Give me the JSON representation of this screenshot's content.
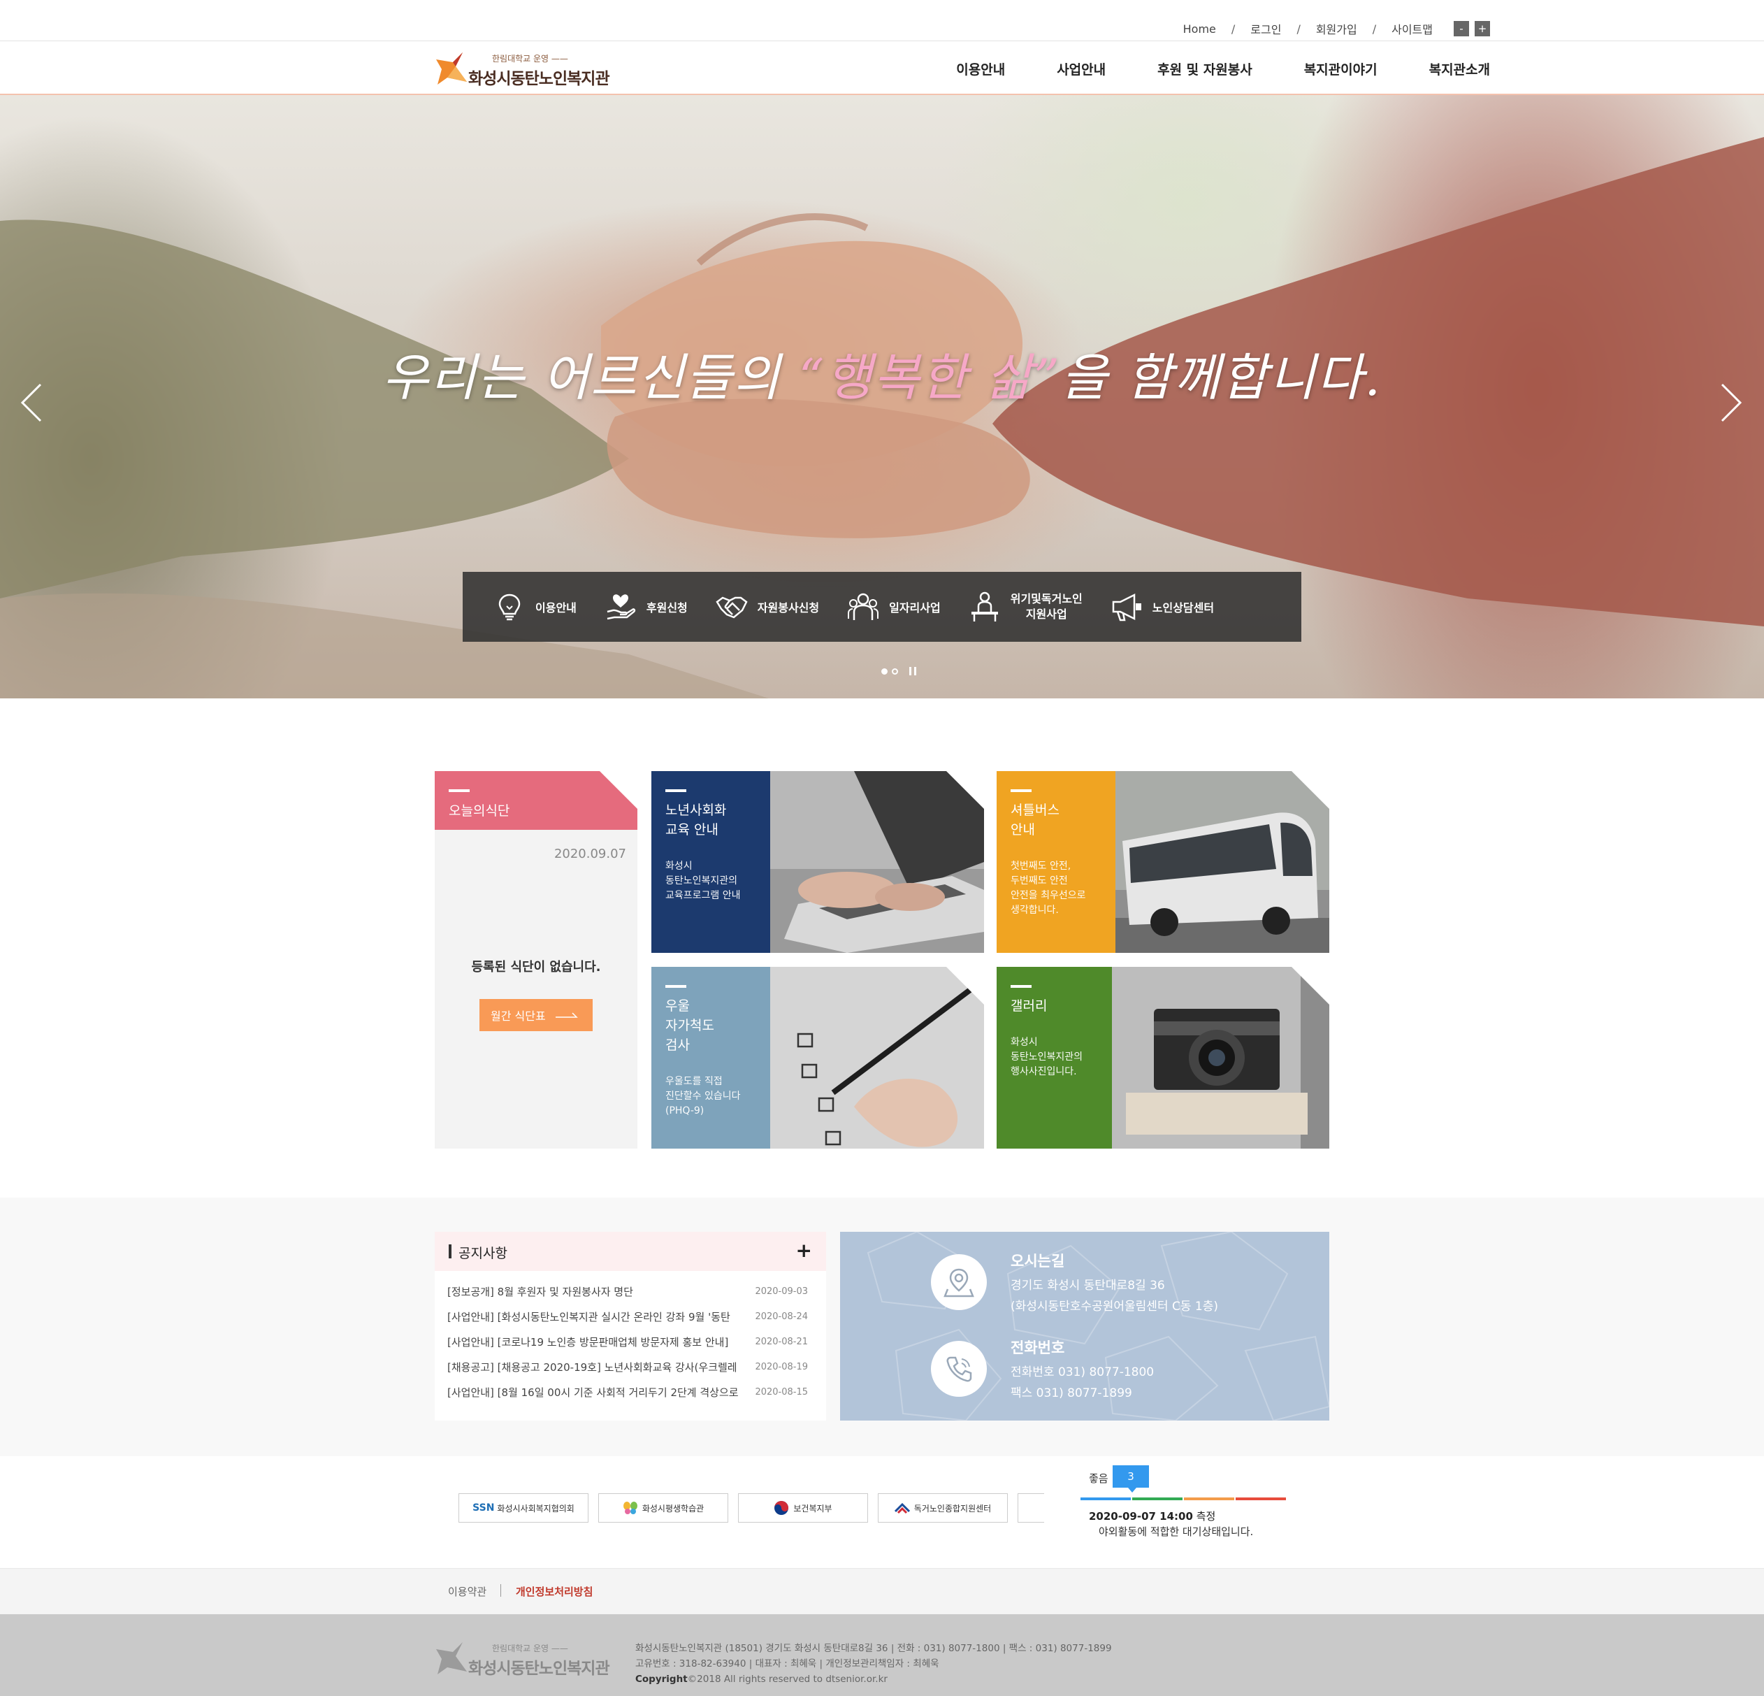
{
  "util": {
    "home": "Home",
    "login": "로그인",
    "join": "회원가입",
    "sitemap": "사이트맵",
    "zoom_out": "-",
    "zoom_in": "+",
    "sep": "/"
  },
  "header": {
    "logo_sub": "한림대학교 운영 ——",
    "logo_name": "화성시동탄노인복지관",
    "nav": [
      "이용안내",
      "사업안내",
      "후원 및 자원봉사",
      "복지관이야기",
      "복지관소개"
    ]
  },
  "hero": {
    "headline_pre": "우리는 어르신들의 ",
    "headline_highlight": "“행복한 삶”",
    "headline_post": "을 함께합니다.",
    "quick_links": [
      {
        "label": "이용안내",
        "icon": "lightbulb-icon"
      },
      {
        "label": "후원신청",
        "icon": "heart-hand-icon"
      },
      {
        "label": "자원봉사신청",
        "icon": "handshake-icon"
      },
      {
        "label": "일자리사업",
        "icon": "people-icon"
      },
      {
        "label_1": "위기및독거노인",
        "label_2": "지원사업",
        "icon": "person-podium-icon"
      },
      {
        "label": "노인상담센터",
        "icon": "megaphone-icon"
      }
    ]
  },
  "meal": {
    "title": "오늘의식단",
    "date": "2020.09.07",
    "empty": "등록된 식단이 없습니다.",
    "button": "월간 식단표"
  },
  "tiles": [
    {
      "title_1": "노년사회화",
      "title_2": "교육 안내",
      "desc_1": "화성시",
      "desc_2": "동탄노인복지관의",
      "desc_3": "교육프로그램 안내",
      "color": "#1c3a6e",
      "photo": "laptop-typing"
    },
    {
      "title_1": "셔틀버스",
      "title_2": "안내",
      "desc_1": "첫번째도 안전,",
      "desc_2": "두번째도 안전",
      "desc_3": "안전을 최우선으로",
      "desc_4": "생각합니다.",
      "color": "#f0a422",
      "photo": "bus"
    },
    {
      "title_1": "우울",
      "title_2": "자가척도",
      "title_3": "검사",
      "desc_1": "우울도를 직접",
      "desc_2": "진단할수 있습니다",
      "desc_3": "(PHQ-9)",
      "color": "#7ea3bb",
      "photo": "checklist"
    },
    {
      "title_1": "갤러리",
      "desc_1": "화성시",
      "desc_2": "동탄노인복지관의",
      "desc_3": "행사사진입니다.",
      "color": "#4f8a2a",
      "photo": "camera"
    }
  ],
  "notice": {
    "title": "공지사항",
    "more": "+",
    "items": [
      {
        "text": "[정보공개] 8월 후원자 및 자원봉사자 명단",
        "date": "2020-09-03"
      },
      {
        "text": "[사업안내] [화성시동탄노인복지관 실시간 온라인 강좌 9월 '동탄",
        "date": "2020-08-24"
      },
      {
        "text": "[사업안내] [코로나19 노인층 방문판매업체 방문자제 홍보 안내]",
        "date": "2020-08-21"
      },
      {
        "text": "[채용공고] [채용공고 2020-19호] 노년사회화교육 강사(우크렐레",
        "date": "2020-08-19"
      },
      {
        "text": "[사업안내] [8월 16일 00시 기준 사회적 거리두기 2단계 격상으로",
        "date": "2020-08-15"
      }
    ]
  },
  "directions": {
    "title": "오시는길",
    "addr_1": "경기도 화성시 동탄대로8길 36",
    "addr_2": "(화성시동탄호수공원어울림센터 C동 1층)",
    "phone_title": "전화번호",
    "phone": "전화번호 031) 8077-1800",
    "fax": "팩스 031) 8077-1899"
  },
  "partners": [
    {
      "label": "화성시사회복지협의회",
      "brand": "SSN"
    },
    {
      "label": "화성시평생학습관",
      "brand": ""
    },
    {
      "label": "보건복지부",
      "brand": ""
    },
    {
      "label": "독거노인종합지원센터",
      "brand": ""
    }
  ],
  "air": {
    "label": "좋음",
    "value": "3",
    "time": "2020-09-07 14:00",
    "time_suffix": " 측정",
    "message": "야외활동에 적합한 대기상태입니다.",
    "scale_colors": [
      "#3399ee",
      "#33aa55",
      "#f39c4a",
      "#e74c3c"
    ]
  },
  "footer": {
    "terms": "이용약관",
    "privacy": "개인정보처리방침",
    "logo_sub": "한림대학교 운영 ——",
    "logo_name": "화성시동탄노인복지관",
    "line_1": "화성시동탄노인복지관 (18501) 경기도 화성시 동탄대로8길 36 |  전화 : 031) 8077-1800  |  팩스 : 031) 8077-1899",
    "line_2": "고유번호 : 318-82-63940  |  대표자 : 최혜욱  |  개인정보관리책임자 : 최혜욱",
    "copyright_label": "Copyright",
    "copyright": "©2018 All rights reserved to dtsenior.or.kr"
  }
}
